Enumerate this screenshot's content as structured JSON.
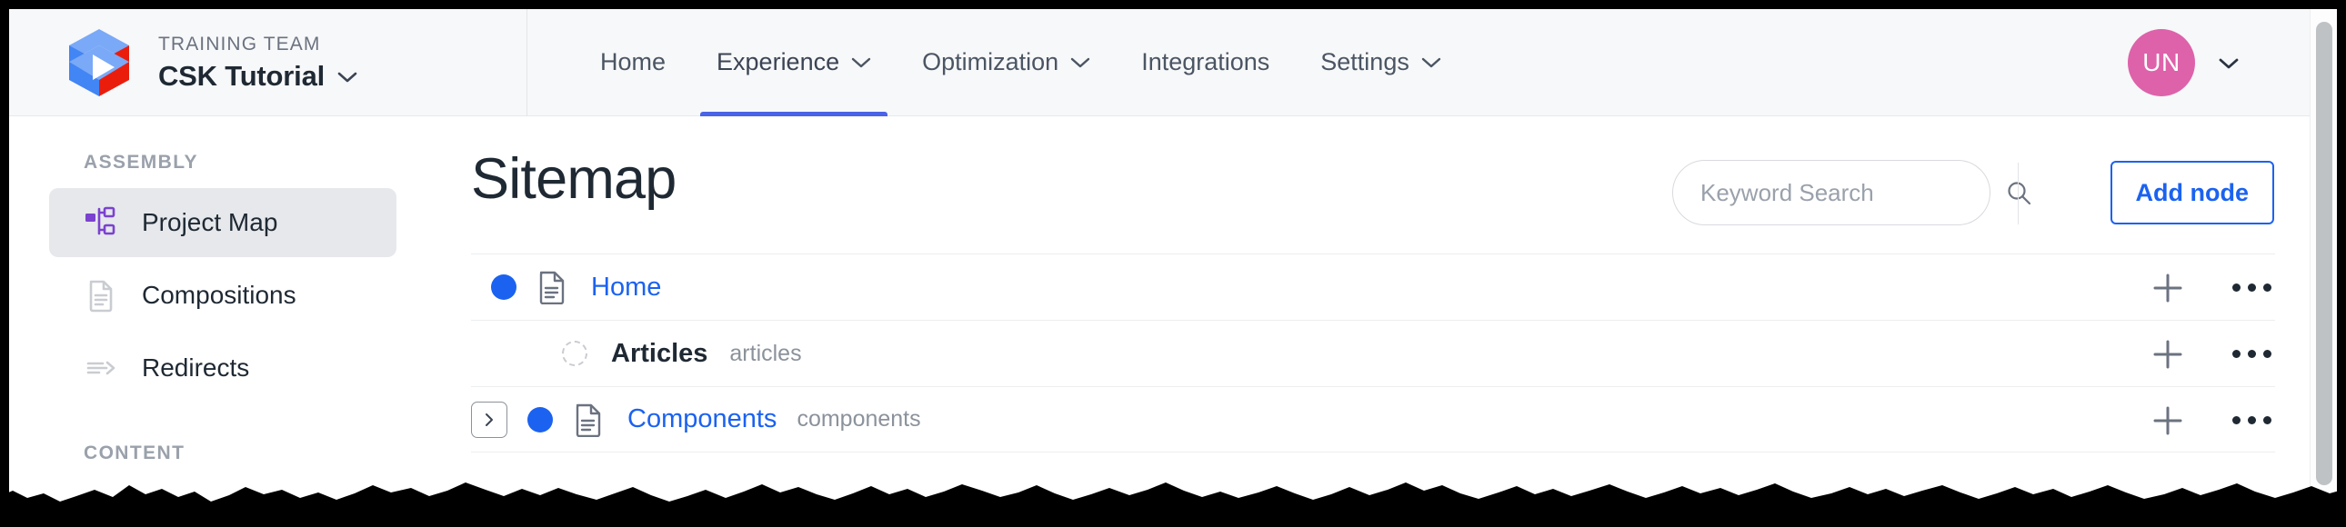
{
  "brand": {
    "kicker": "TRAINING TEAM",
    "title": "CSK Tutorial",
    "caret_icon": "chevron-down-icon",
    "logo_icon": "app-logo-cube-icon"
  },
  "nav": {
    "items": [
      {
        "label": "Home",
        "has_caret": false,
        "active": false
      },
      {
        "label": "Experience",
        "has_caret": true,
        "active": true
      },
      {
        "label": "Optimization",
        "has_caret": true,
        "active": false
      },
      {
        "label": "Integrations",
        "has_caret": false,
        "active": false
      },
      {
        "label": "Settings",
        "has_caret": true,
        "active": false
      }
    ]
  },
  "user": {
    "initials": "UN",
    "avatar_color": "#dd62aa",
    "caret_icon": "chevron-down-icon"
  },
  "sidebar": {
    "sections": [
      {
        "label": "ASSEMBLY",
        "items": [
          {
            "label": "Project Map",
            "icon": "sitemap-icon",
            "selected": true
          },
          {
            "label": "Compositions",
            "icon": "document-icon",
            "selected": false
          },
          {
            "label": "Redirects",
            "icon": "redirect-arrow-icon",
            "selected": false
          }
        ]
      },
      {
        "label": "CONTENT",
        "items": []
      }
    ]
  },
  "main": {
    "title": "Sitemap",
    "search": {
      "placeholder": "Keyword Search",
      "value": "",
      "icon": "search-icon"
    },
    "add_node_label": "Add node",
    "accent_color": "#1b62f0",
    "rows": [
      {
        "title": "Home",
        "slug": "",
        "is_link": true,
        "indent": 0,
        "has_expander": false,
        "dot": "filled",
        "has_doc_icon": true,
        "add_icon": "plus-icon",
        "menu_icon": "more-horizontal-icon"
      },
      {
        "title": "Articles",
        "slug": "articles",
        "is_link": false,
        "indent": 1,
        "has_expander": false,
        "dot": "empty",
        "has_doc_icon": false,
        "add_icon": "plus-icon",
        "menu_icon": "more-horizontal-icon"
      },
      {
        "title": "Components",
        "slug": "components",
        "is_link": true,
        "indent": 0,
        "has_expander": true,
        "dot": "filled",
        "has_doc_icon": true,
        "add_icon": "plus-icon",
        "menu_icon": "more-horizontal-icon"
      }
    ]
  },
  "scrollbar": {
    "name": "vertical-scrollbar"
  }
}
